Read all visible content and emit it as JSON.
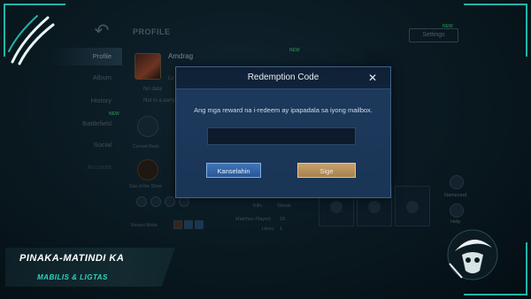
{
  "header": {
    "back_icon": "back-arrow-icon",
    "title": "PROFILE",
    "settings_label": "Settings",
    "settings_new": "NEW",
    "icons_new": "NEW"
  },
  "tabs": [
    {
      "label": "Profile",
      "active": true
    },
    {
      "label": "Album"
    },
    {
      "label": "History"
    },
    {
      "label": "Battlefield",
      "badge": "NEW"
    },
    {
      "label": "Social"
    },
    {
      "label": "Account"
    }
  ],
  "profile": {
    "name": "Amdrag",
    "level_prefix": "Lv",
    "no_data": "No data",
    "not_in_party": "Not in a party",
    "current_rank": "Current Rank",
    "star_of_show": "Star of the Show",
    "recent_mode": "Recent Mode",
    "recent_values": [
      "19"
    ],
    "matches_label": "Matches Played:",
    "matches_value": "19",
    "likes_label": "Likes:",
    "likes_value": "1",
    "stat_labels": [
      "Kills",
      "Streak"
    ]
  },
  "right_side": {
    "labels": [
      "Namecard",
      "Help"
    ]
  },
  "dialog": {
    "title": "Redemption Code",
    "message": "Ang mga reward na i-redeem ay ipapadala sa iyong mailbox.",
    "input_value": "",
    "input_placeholder": "",
    "cancel_label": "Kanselahin",
    "confirm_label": "Sige",
    "close_icon": "close-icon"
  },
  "banner": {
    "line1": "PINAKA-MATINDI KA",
    "line2": "MABILIS & LIGTAS"
  },
  "colors": {
    "accent": "#1fb5a8",
    "dialog_bg": "#1d3a5d",
    "confirm_btn": "#c8a06a",
    "cancel_btn": "#3f75b8"
  }
}
